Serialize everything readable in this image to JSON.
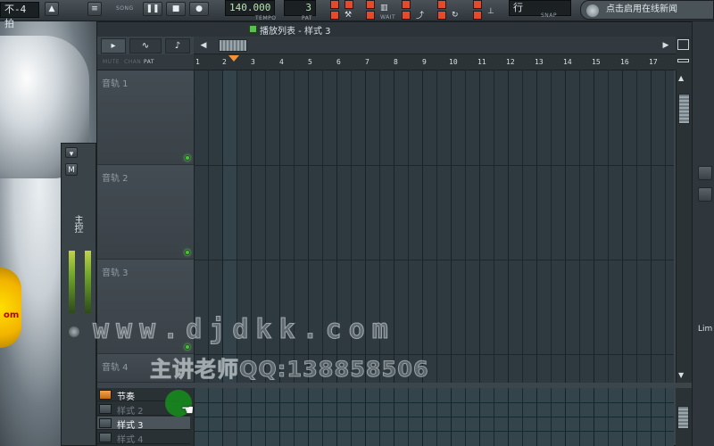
{
  "toolbar": {
    "beat_label": "不-4拍",
    "song_label": "SONG",
    "tempo_value": "140.000",
    "tempo_label": "TEMPO",
    "pattern_value": "3",
    "pattern_label": "PAT",
    "wait_label": "WAIT",
    "snap_label": "SNAP",
    "snap_value": "行",
    "news_text": "点击启用在线新闻"
  },
  "playlist": {
    "title": "播放列表 - 样式 3",
    "header_labels": [
      "MUTE",
      "CHAN",
      "PAT"
    ],
    "ruler": [
      "1",
      "2",
      "3",
      "4",
      "5",
      "6",
      "7",
      "8",
      "9",
      "10",
      "11",
      "12",
      "13",
      "14",
      "15",
      "16",
      "17"
    ],
    "tracks": [
      "音轨 1",
      "音轨 2",
      "音轨 3",
      "音轨 4"
    ],
    "patterns": [
      {
        "label": "节奏",
        "active": true
      },
      {
        "label": "样式 2",
        "active": false
      },
      {
        "label": "样式 3",
        "active": false,
        "selected": true
      },
      {
        "label": "样式 4",
        "active": false
      }
    ]
  },
  "mixer": {
    "label": "主控"
  },
  "right_panel": {
    "lim_label": "Lim"
  },
  "watermark": {
    "url": "www.djdkk.com",
    "teacher": "主讲老师QQ:138858506"
  },
  "logo_text": "om",
  "colors": {
    "accent_orange": "#f0933a",
    "led_green": "#4ac23c",
    "grid_bg": "#2e3a40"
  }
}
